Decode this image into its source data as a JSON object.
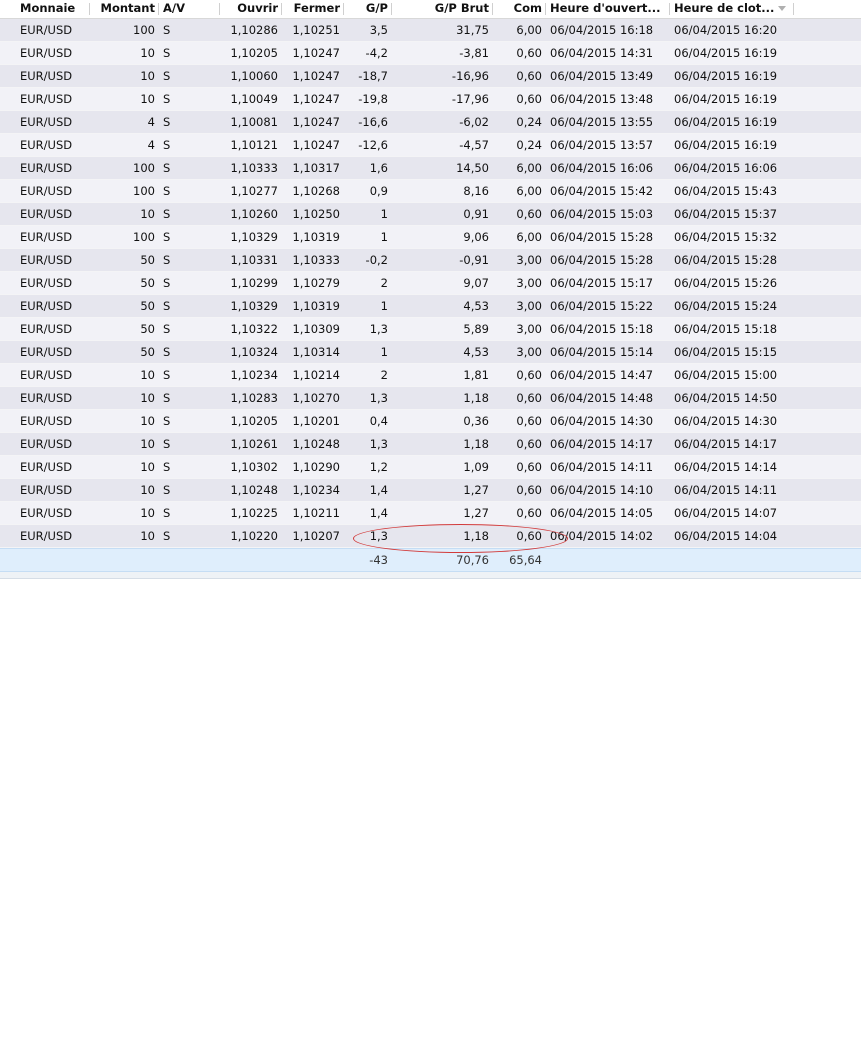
{
  "columns": {
    "monnaie": "Monnaie",
    "montant": "Montant",
    "av": "A/V",
    "ouvrir": "Ouvrir",
    "fermer": "Fermer",
    "gp": "G/P",
    "gp_brut": "G/P Brut",
    "com": "Com",
    "heure_ouverture": "Heure d'ouvert...",
    "heure_cloture": "Heure de clot..."
  },
  "sort_icon": "sort-descending-icon",
  "rows": [
    [
      "EUR/USD",
      "100",
      "S",
      "1,10286",
      "1,10251",
      "3,5",
      "31,75",
      "6,00",
      "06/04/2015 16:18",
      "06/04/2015 16:20"
    ],
    [
      "EUR/USD",
      "10",
      "S",
      "1,10205",
      "1,10247",
      "-4,2",
      "-3,81",
      "0,60",
      "06/04/2015 14:31",
      "06/04/2015 16:19"
    ],
    [
      "EUR/USD",
      "10",
      "S",
      "1,10060",
      "1,10247",
      "-18,7",
      "-16,96",
      "0,60",
      "06/04/2015 13:49",
      "06/04/2015 16:19"
    ],
    [
      "EUR/USD",
      "10",
      "S",
      "1,10049",
      "1,10247",
      "-19,8",
      "-17,96",
      "0,60",
      "06/04/2015 13:48",
      "06/04/2015 16:19"
    ],
    [
      "EUR/USD",
      "4",
      "S",
      "1,10081",
      "1,10247",
      "-16,6",
      "-6,02",
      "0,24",
      "06/04/2015 13:55",
      "06/04/2015 16:19"
    ],
    [
      "EUR/USD",
      "4",
      "S",
      "1,10121",
      "1,10247",
      "-12,6",
      "-4,57",
      "0,24",
      "06/04/2015 13:57",
      "06/04/2015 16:19"
    ],
    [
      "EUR/USD",
      "100",
      "S",
      "1,10333",
      "1,10317",
      "1,6",
      "14,50",
      "6,00",
      "06/04/2015 16:06",
      "06/04/2015 16:06"
    ],
    [
      "EUR/USD",
      "100",
      "S",
      "1,10277",
      "1,10268",
      "0,9",
      "8,16",
      "6,00",
      "06/04/2015 15:42",
      "06/04/2015 15:43"
    ],
    [
      "EUR/USD",
      "10",
      "S",
      "1,10260",
      "1,10250",
      "1",
      "0,91",
      "0,60",
      "06/04/2015 15:03",
      "06/04/2015 15:37"
    ],
    [
      "EUR/USD",
      "100",
      "S",
      "1,10329",
      "1,10319",
      "1",
      "9,06",
      "6,00",
      "06/04/2015 15:28",
      "06/04/2015 15:32"
    ],
    [
      "EUR/USD",
      "50",
      "S",
      "1,10331",
      "1,10333",
      "-0,2",
      "-0,91",
      "3,00",
      "06/04/2015 15:28",
      "06/04/2015 15:28"
    ],
    [
      "EUR/USD",
      "50",
      "S",
      "1,10299",
      "1,10279",
      "2",
      "9,07",
      "3,00",
      "06/04/2015 15:17",
      "06/04/2015 15:26"
    ],
    [
      "EUR/USD",
      "50",
      "S",
      "1,10329",
      "1,10319",
      "1",
      "4,53",
      "3,00",
      "06/04/2015 15:22",
      "06/04/2015 15:24"
    ],
    [
      "EUR/USD",
      "50",
      "S",
      "1,10322",
      "1,10309",
      "1,3",
      "5,89",
      "3,00",
      "06/04/2015 15:18",
      "06/04/2015 15:18"
    ],
    [
      "EUR/USD",
      "50",
      "S",
      "1,10324",
      "1,10314",
      "1",
      "4,53",
      "3,00",
      "06/04/2015 15:14",
      "06/04/2015 15:15"
    ],
    [
      "EUR/USD",
      "10",
      "S",
      "1,10234",
      "1,10214",
      "2",
      "1,81",
      "0,60",
      "06/04/2015 14:47",
      "06/04/2015 15:00"
    ],
    [
      "EUR/USD",
      "10",
      "S",
      "1,10283",
      "1,10270",
      "1,3",
      "1,18",
      "0,60",
      "06/04/2015 14:48",
      "06/04/2015 14:50"
    ],
    [
      "EUR/USD",
      "10",
      "S",
      "1,10205",
      "1,10201",
      "0,4",
      "0,36",
      "0,60",
      "06/04/2015 14:30",
      "06/04/2015 14:30"
    ],
    [
      "EUR/USD",
      "10",
      "S",
      "1,10261",
      "1,10248",
      "1,3",
      "1,18",
      "0,60",
      "06/04/2015 14:17",
      "06/04/2015 14:17"
    ],
    [
      "EUR/USD",
      "10",
      "S",
      "1,10302",
      "1,10290",
      "1,2",
      "1,09",
      "0,60",
      "06/04/2015 14:11",
      "06/04/2015 14:14"
    ],
    [
      "EUR/USD",
      "10",
      "S",
      "1,10248",
      "1,10234",
      "1,4",
      "1,27",
      "0,60",
      "06/04/2015 14:10",
      "06/04/2015 14:11"
    ],
    [
      "EUR/USD",
      "10",
      "S",
      "1,10225",
      "1,10211",
      "1,4",
      "1,27",
      "0,60",
      "06/04/2015 14:05",
      "06/04/2015 14:07"
    ],
    [
      "EUR/USD",
      "10",
      "S",
      "1,10220",
      "1,10207",
      "1,3",
      "1,18",
      "0,60",
      "06/04/2015 14:02",
      "06/04/2015 14:04"
    ]
  ],
  "totals": {
    "gp": "-43",
    "gp_brut": "70,76",
    "com": "65,64"
  },
  "colors": {
    "row_even": "#e6e6ee",
    "row_odd": "#f2f2f7",
    "total_row": "#dfeefc",
    "highlight_ellipse": "#d23b3b"
  }
}
